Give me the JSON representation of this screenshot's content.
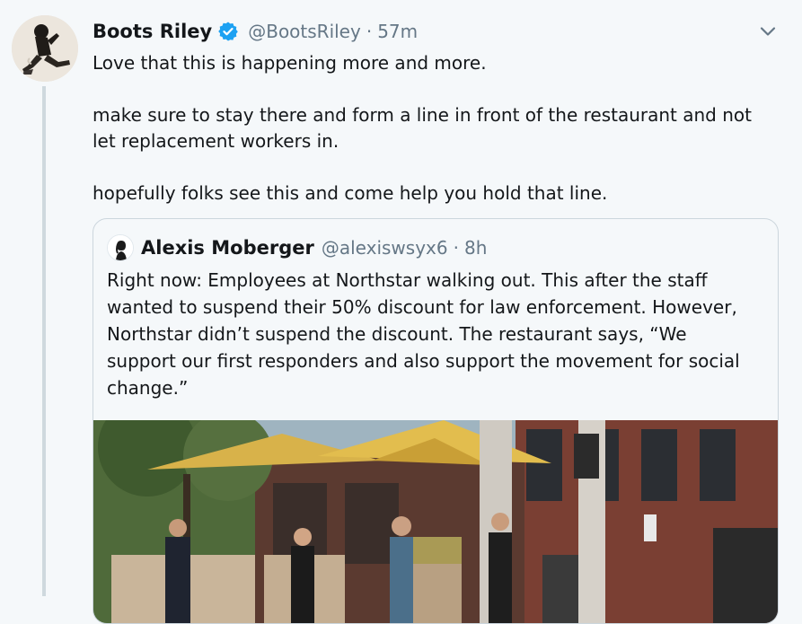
{
  "tweet": {
    "author_name": "Boots Riley",
    "handle": "@BootsRiley",
    "separator": "·",
    "time": "57m",
    "verified_icon": "verified-badge-icon",
    "menu_icon": "chevron-down-icon",
    "lines": [
      "Love that this is happening more and more.",
      "make sure to stay there and form a line in front of the restaurant and not",
      "let replacement workers in.",
      "hopefully folks see this and come help you hold that line."
    ]
  },
  "quoted": {
    "author_name": "Alexis Moberger",
    "handle": "@alexiswsyx6",
    "separator": "·",
    "time": "8h",
    "lines": [
      "Right now: Employees at Northstar walking out. This after the staff",
      "wanted to suspend their 50% discount for law enforcement. However,",
      "Northstar didn’t suspend the discount. The restaurant says, “We",
      "support our first responders and also support the movement for social",
      "change.”"
    ],
    "media_icon": "video-thumbnail"
  },
  "colors": {
    "background": "#f5f8fa",
    "text": "#14171a",
    "muted": "#657786",
    "verified": "#1da1f2",
    "border": "#ccd6dd"
  }
}
